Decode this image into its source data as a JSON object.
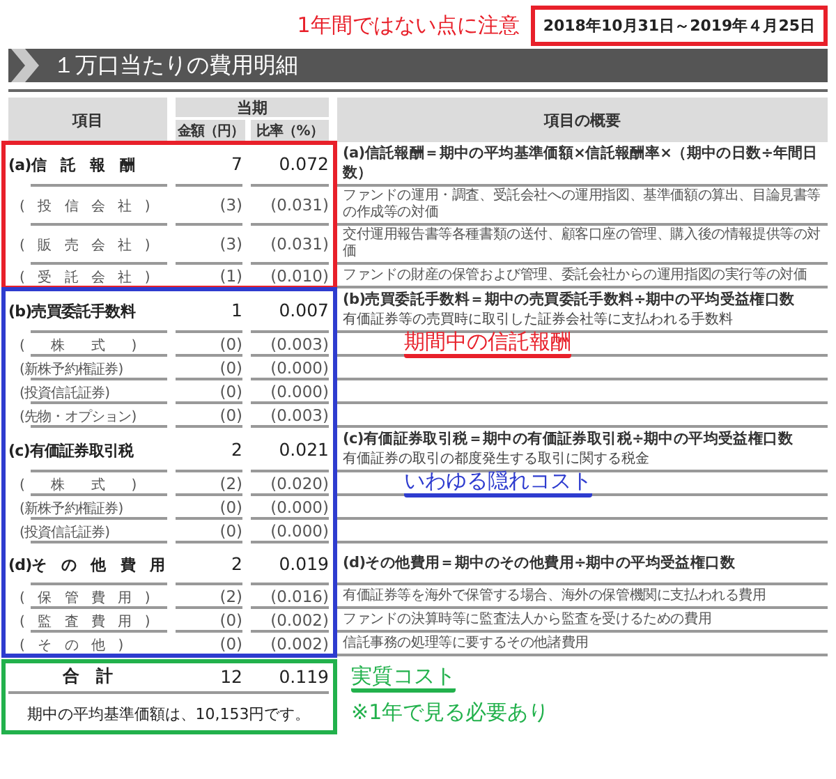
{
  "period_note": {
    "text": "1年間ではない点に注意",
    "color": "#e8202a"
  },
  "period": {
    "text": "2018年10月31日～2019年４月25日",
    "color": "#e8202a"
  },
  "title": "１万口当たりの費用明細",
  "header": {
    "item": "項目",
    "period": "当期",
    "amount": "金額（円）",
    "ratio": "比率（%）",
    "overview": "項目の概要"
  },
  "groups": [
    {
      "color": "#e8202a",
      "rows": [
        {
          "kind": "main",
          "item": "(a)信　託　報　酬",
          "amount": "7",
          "ratio": "0.072",
          "formula": "(a)信託報酬＝期中の平均基準価額×信託報酬率×（期中の日数÷年間日数）"
        },
        {
          "kind": "sub",
          "item": "(　投　信　会　社　)",
          "amount": "(3)",
          "ratio": "(0.031)",
          "description": "ファンドの運用・調査、受託会社への運用指図、基準価額の算出、目論見書等の作成等の対価"
        },
        {
          "kind": "sub",
          "item": "(　販　売　会　社　)",
          "amount": "(3)",
          "ratio": "(0.031)",
          "description": "交付運用報告書等各種書類の送付、顧客口座の管理、購入後の情報提供等の対価"
        },
        {
          "kind": "sub",
          "item": "(　受　託　会　社　)",
          "amount": "(1)",
          "ratio": "(0.010)",
          "description": "ファンドの財産の保管および管理、委託会社からの運用指図の実行等の対価"
        }
      ]
    },
    {
      "color": "#2e3ccf",
      "rows": [
        {
          "kind": "main",
          "item": "(b)売買委託手数料",
          "amount": "1",
          "ratio": "0.007",
          "formula": "(b)売買委託手数料＝期中の売買委託手数料÷期中の平均受益権口数",
          "description": "有価証券等の売買時に取引した証券会社等に支払われる手数料"
        },
        {
          "kind": "sub",
          "item": "(　　株　　式　　)",
          "amount": "(0)",
          "ratio": "(0.003)",
          "note": {
            "text": "期間中の信託報酬",
            "color": "#e8202a",
            "underline": true
          }
        },
        {
          "kind": "sub",
          "item": "(新株予約権証券)",
          "amount": "(0)",
          "ratio": "(0.000)"
        },
        {
          "kind": "sub",
          "item": "(投資信託証券)",
          "amount": "(0)",
          "ratio": "(0.000)"
        },
        {
          "kind": "sub",
          "item": "(先物・オプション)",
          "amount": "(0)",
          "ratio": "(0.003)"
        },
        {
          "kind": "main",
          "item": "(c)有価証券取引税",
          "amount": "2",
          "ratio": "0.021",
          "formula": "(c)有価証券取引税＝期中の有価証券取引税÷期中の平均受益権口数",
          "description": "有価証券の取引の都度発生する取引に関する税金"
        },
        {
          "kind": "sub",
          "item": "(　　株　　式　　)",
          "amount": "(2)",
          "ratio": "(0.020)",
          "note": {
            "text": "いわゆる隠れコスト",
            "color": "#2e3ccf",
            "underline": true
          }
        },
        {
          "kind": "sub",
          "item": "(新株予約権証券)",
          "amount": "(0)",
          "ratio": "(0.000)"
        },
        {
          "kind": "sub",
          "item": "(投資信託証券)",
          "amount": "(0)",
          "ratio": "(0.000)"
        },
        {
          "kind": "main",
          "item": "(d)そ　の　他　費　用",
          "amount": "2",
          "ratio": "0.019",
          "formula": "(d)その他費用＝期中のその他費用÷期中の平均受益権口数"
        },
        {
          "kind": "sub",
          "item": "(　保　管　費　用　)",
          "amount": "(2)",
          "ratio": "(0.016)",
          "description": "有価証券等を海外で保管する場合、海外の保管機関に支払われる費用"
        },
        {
          "kind": "sub",
          "item": "(　監　査　費　用　)",
          "amount": "(0)",
          "ratio": "(0.002)",
          "description": "ファンドの決算時等に監査法人から監査を受けるための費用"
        },
        {
          "kind": "sub",
          "item": "(　そ　の　他　)",
          "amount": "(0)",
          "ratio": "(0.002)",
          "description": "信託事務の処理等に要するその他諸費用"
        }
      ]
    }
  ],
  "total": {
    "color": "#22b14c",
    "label": "合　計",
    "amount": "12",
    "ratio": "0.119",
    "average": "期中の平均基準価額は、10,153円です。",
    "notes": [
      {
        "text": "実質コスト",
        "color": "#22b14c",
        "underline": true
      },
      {
        "text": "※1年で見る必要あり",
        "color": "#22b14c",
        "underline": false
      }
    ]
  }
}
